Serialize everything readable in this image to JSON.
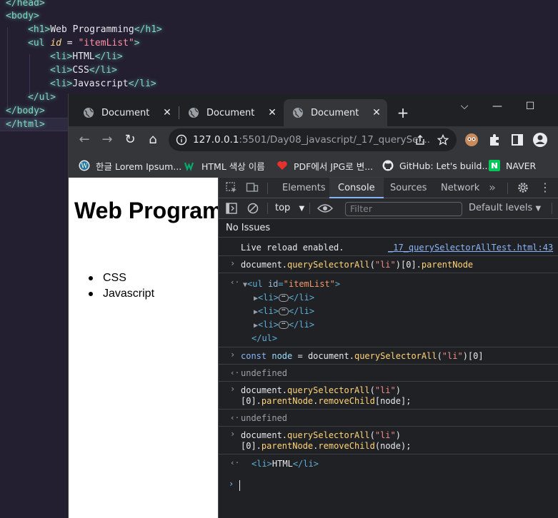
{
  "editor": {
    "lines": [
      {
        "indent": 0,
        "parts": [
          {
            "c": "tag",
            "t": "</head>"
          }
        ]
      },
      {
        "indent": 0,
        "parts": [
          {
            "c": "tag",
            "t": "<body>"
          }
        ]
      },
      {
        "indent": 1,
        "parts": [
          {
            "c": "tag",
            "t": "<h1>"
          },
          {
            "c": "txt",
            "t": "Web Programming"
          },
          {
            "c": "tag",
            "t": "</h1>"
          }
        ]
      },
      {
        "indent": 1,
        "parts": [
          {
            "c": "tag",
            "t": "<ul "
          },
          {
            "c": "attr",
            "t": "id"
          },
          {
            "c": "eq",
            "t": " = "
          },
          {
            "c": "str",
            "t": "\"itemList\""
          },
          {
            "c": "tag",
            "t": ">"
          }
        ]
      },
      {
        "indent": 2,
        "parts": [
          {
            "c": "tag",
            "t": "<li>"
          },
          {
            "c": "txt",
            "t": "HTML"
          },
          {
            "c": "tag",
            "t": "</li>"
          }
        ]
      },
      {
        "indent": 2,
        "parts": [
          {
            "c": "tag",
            "t": "<li>"
          },
          {
            "c": "txt",
            "t": "CSS"
          },
          {
            "c": "tag",
            "t": "</li>"
          }
        ]
      },
      {
        "indent": 2,
        "parts": [
          {
            "c": "tag",
            "t": "<li>"
          },
          {
            "c": "txt",
            "t": "Javascript"
          },
          {
            "c": "tag",
            "t": "</li>"
          }
        ]
      },
      {
        "indent": 1,
        "parts": [
          {
            "c": "tag",
            "t": "</ul>"
          }
        ]
      },
      {
        "indent": 0,
        "parts": [
          {
            "c": "tag",
            "t": "</body>"
          }
        ]
      },
      {
        "indent": 0,
        "parts": [
          {
            "c": "tag",
            "t": "</html>"
          }
        ]
      }
    ]
  },
  "browser": {
    "tabs": [
      {
        "title": "Document",
        "active": false
      },
      {
        "title": "Document",
        "active": false
      },
      {
        "title": "Document",
        "active": true
      }
    ],
    "url_host": "127.0.0.1",
    "url_rest": ":5501/Day08_javascript/_17_querySel...",
    "bookmarks": [
      {
        "label": "한글 Lorem Ipsum...",
        "icon": "wordpress-icon"
      },
      {
        "label": "HTML 색상 이름",
        "icon": "w3schools-icon"
      },
      {
        "label": "PDF에서 JPG로 변...",
        "icon": "heart-icon"
      },
      {
        "label": "GitHub: Let's build...",
        "icon": "github-icon"
      },
      {
        "label": "NAVER",
        "icon": "naver-icon"
      }
    ]
  },
  "page": {
    "heading": "Web Programming",
    "items": [
      "CSS",
      "Javascript"
    ]
  },
  "devtools": {
    "tabs": [
      "Elements",
      "Console",
      "Sources",
      "Network"
    ],
    "active_tab": "Console",
    "context": "top",
    "filter_placeholder": "Filter",
    "levels": "Default levels",
    "issues": "No Issues",
    "console": {
      "live_reload": "Live reload enabled.",
      "live_reload_src": "_17_querySelectorAllTest.html:43",
      "cmd1_a": "document.",
      "cmd1_fn": "querySelectorAll",
      "cmd1_b": "(",
      "cmd1_str": "\"li\"",
      "cmd1_c": ")[0].",
      "cmd1_prop": "parentNode",
      "ul_open_tag": "<ul",
      "ul_attr": "id",
      "ul_attr_eq": "=",
      "ul_attr_val": "\"itemList\"",
      "ul_open_end": ">",
      "li_open": "<li>",
      "li_ellipsis": "⋯",
      "li_close": "</li>",
      "ul_close": "</ul>",
      "cmd2_kw": "const",
      "cmd2_var": "node",
      "cmd2_eq": " = document.",
      "cmd2_fn": "querySelectorAll",
      "cmd2_b": "(",
      "cmd2_str": "\"li\"",
      "cmd2_c": ")[0]",
      "undefined": "undefined",
      "cmd3_a": "document.",
      "cmd3_fn": "querySelectorAll",
      "cmd3_b": "(",
      "cmd3_str": "\"li\"",
      "cmd3_c": ")",
      "cmd3_l2a": "[0].",
      "cmd3_prop": "parentNode",
      "cmd3_l2b": ".",
      "cmd3_fn2": "removeChild",
      "cmd3_l2c": "[node];",
      "cmd4_l2c": "(node);",
      "result_li": "<li>",
      "result_text": "HTML",
      "result_li_close": "</li>"
    }
  },
  "colors": {
    "accent": "#8ab4f8",
    "editor_bg": "#231f30",
    "devtools_bg": "#202124"
  }
}
